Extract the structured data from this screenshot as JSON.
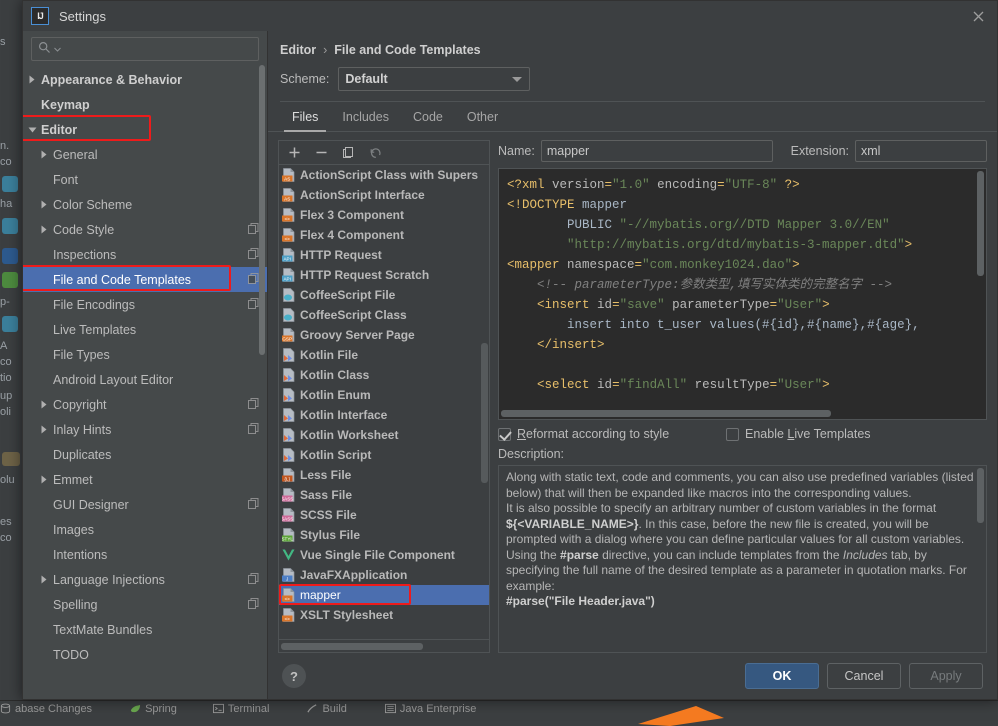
{
  "window": {
    "title": "Settings",
    "logo_text": "IJ",
    "close_icon": "close-icon"
  },
  "sidebar": {
    "search": {
      "placeholder": "",
      "value": "",
      "icon": "search-icon"
    },
    "items": [
      {
        "label": "Appearance & Behavior",
        "level": 0,
        "arrow": "right",
        "bold": true,
        "copy": false,
        "selected": false
      },
      {
        "label": "Keymap",
        "level": 0,
        "arrow": "none",
        "bold": true,
        "copy": false,
        "selected": false
      },
      {
        "label": "Editor",
        "level": 0,
        "arrow": "down",
        "bold": true,
        "copy": false,
        "selected": false,
        "annotated": true
      },
      {
        "label": "General",
        "level": 1,
        "arrow": "right",
        "bold": false,
        "copy": false,
        "selected": false
      },
      {
        "label": "Font",
        "level": 1,
        "arrow": "none",
        "bold": false,
        "copy": false,
        "selected": false
      },
      {
        "label": "Color Scheme",
        "level": 1,
        "arrow": "right",
        "bold": false,
        "copy": false,
        "selected": false
      },
      {
        "label": "Code Style",
        "level": 1,
        "arrow": "right",
        "bold": false,
        "copy": true,
        "selected": false
      },
      {
        "label": "Inspections",
        "level": 1,
        "arrow": "none",
        "bold": false,
        "copy": true,
        "selected": false
      },
      {
        "label": "File and Code Templates",
        "level": 1,
        "arrow": "none",
        "bold": false,
        "copy": true,
        "selected": true,
        "annotated": true
      },
      {
        "label": "File Encodings",
        "level": 1,
        "arrow": "none",
        "bold": false,
        "copy": true,
        "selected": false
      },
      {
        "label": "Live Templates",
        "level": 1,
        "arrow": "none",
        "bold": false,
        "copy": false,
        "selected": false
      },
      {
        "label": "File Types",
        "level": 1,
        "arrow": "none",
        "bold": false,
        "copy": false,
        "selected": false
      },
      {
        "label": "Android Layout Editor",
        "level": 1,
        "arrow": "none",
        "bold": false,
        "copy": false,
        "selected": false
      },
      {
        "label": "Copyright",
        "level": 1,
        "arrow": "right",
        "bold": false,
        "copy": true,
        "selected": false
      },
      {
        "label": "Inlay Hints",
        "level": 1,
        "arrow": "right",
        "bold": false,
        "copy": true,
        "selected": false
      },
      {
        "label": "Duplicates",
        "level": 1,
        "arrow": "none",
        "bold": false,
        "copy": false,
        "selected": false
      },
      {
        "label": "Emmet",
        "level": 1,
        "arrow": "right",
        "bold": false,
        "copy": false,
        "selected": false
      },
      {
        "label": "GUI Designer",
        "level": 1,
        "arrow": "none",
        "bold": false,
        "copy": true,
        "selected": false
      },
      {
        "label": "Images",
        "level": 1,
        "arrow": "none",
        "bold": false,
        "copy": false,
        "selected": false
      },
      {
        "label": "Intentions",
        "level": 1,
        "arrow": "none",
        "bold": false,
        "copy": false,
        "selected": false
      },
      {
        "label": "Language Injections",
        "level": 1,
        "arrow": "right",
        "bold": false,
        "copy": true,
        "selected": false
      },
      {
        "label": "Spelling",
        "level": 1,
        "arrow": "none",
        "bold": false,
        "copy": true,
        "selected": false
      },
      {
        "label": "TextMate Bundles",
        "level": 1,
        "arrow": "none",
        "bold": false,
        "copy": false,
        "selected": false
      },
      {
        "label": "TODO",
        "level": 1,
        "arrow": "none",
        "bold": false,
        "copy": false,
        "selected": false
      }
    ]
  },
  "breadcrumb": {
    "parent": "Editor",
    "separator": "›",
    "current": "File and Code Templates"
  },
  "scheme": {
    "label": "Scheme:",
    "value": "Default"
  },
  "tabs": [
    {
      "label": "Files",
      "active": true
    },
    {
      "label": "Includes",
      "active": false
    },
    {
      "label": "Code",
      "active": false
    },
    {
      "label": "Other",
      "active": false
    }
  ],
  "list_toolbar": [
    {
      "name": "add-template-button",
      "glyph": "+"
    },
    {
      "name": "remove-template-button",
      "glyph": "−"
    },
    {
      "name": "copy-template-button",
      "glyph": "copy-icon"
    },
    {
      "name": "reset-template-button",
      "glyph": "undo-icon"
    }
  ],
  "templates": [
    {
      "label": "ActionScript Class with Supers",
      "icon": "as-file-icon",
      "selected": false
    },
    {
      "label": "ActionScript Interface",
      "icon": "as-file-icon",
      "selected": false
    },
    {
      "label": "Flex 3 Component",
      "icon": "xml-file-icon",
      "selected": false
    },
    {
      "label": "Flex 4 Component",
      "icon": "xml-file-icon",
      "selected": false
    },
    {
      "label": "HTTP Request",
      "icon": "api-file-icon",
      "selected": false
    },
    {
      "label": "HTTP Request Scratch",
      "icon": "api-file-icon",
      "selected": false
    },
    {
      "label": "CoffeeScript File",
      "icon": "coffee-file-icon",
      "selected": false
    },
    {
      "label": "CoffeeScript Class",
      "icon": "coffee-file-icon",
      "selected": false
    },
    {
      "label": "Groovy Server Page",
      "icon": "gsp-file-icon",
      "selected": false
    },
    {
      "label": "Kotlin File",
      "icon": "kotlin-file-icon",
      "selected": false
    },
    {
      "label": "Kotlin Class",
      "icon": "kotlin-file-icon",
      "selected": false
    },
    {
      "label": "Kotlin Enum",
      "icon": "kotlin-file-icon",
      "selected": false
    },
    {
      "label": "Kotlin Interface",
      "icon": "kotlin-file-icon",
      "selected": false
    },
    {
      "label": "Kotlin Worksheet",
      "icon": "kotlin-file-icon",
      "selected": false
    },
    {
      "label": "Kotlin Script",
      "icon": "kotlin-file-icon",
      "selected": false
    },
    {
      "label": "Less File",
      "icon": "less-file-icon",
      "selected": false
    },
    {
      "label": "Sass File",
      "icon": "sass-file-icon",
      "selected": false
    },
    {
      "label": "SCSS File",
      "icon": "sass-file-icon",
      "selected": false
    },
    {
      "label": "Stylus File",
      "icon": "stylus-file-icon",
      "selected": false
    },
    {
      "label": "Vue Single File Component",
      "icon": "vue-file-icon",
      "selected": false
    },
    {
      "label": "JavaFXApplication",
      "icon": "java-file-icon",
      "selected": false
    },
    {
      "label": "mapper",
      "icon": "xml-file-icon",
      "selected": true,
      "annotated": true
    },
    {
      "label": "XSLT Stylesheet",
      "icon": "xml-file-icon",
      "selected": false
    }
  ],
  "editor": {
    "name_label": "Name:",
    "name_value": "mapper",
    "extension_label": "Extension:",
    "extension_value": "xml",
    "code_lines": [
      "<?xml version=\"1.0\" encoding=\"UTF-8\" ?>",
      "<!DOCTYPE mapper",
      "        PUBLIC \"-//mybatis.org//DTD Mapper 3.0//EN\"",
      "        \"http://mybatis.org/dtd/mybatis-3-mapper.dtd\">",
      "<mapper namespace=\"com.monkey1024.dao\">",
      "    <!-- parameterType:参数类型,填写实体类的完整名字 -->",
      "    <insert id=\"save\" parameterType=\"User\">",
      "        insert into t_user values(#{id},#{name},#{age},",
      "    </insert>",
      "",
      "    <select id=\"findAll\" resultType=\"User\">"
    ]
  },
  "options": {
    "reformat": {
      "label": "Reformat according to style",
      "mnemonic": "R",
      "checked": true
    },
    "live_templates": {
      "label": "Enable Live Templates",
      "mnemonic": "L",
      "checked": false
    }
  },
  "description": {
    "label": "Description:",
    "paragraphs": [
      "Along with static text, code and comments, you can also use predefined variables (listed below) that will then be expanded like macros into the corresponding values.",
      "It is also possible to specify an arbitrary number of custom variables in the format ${<VARIABLE_NAME>}. In this case, before the new file is created, you will be prompted with a dialog where you can define particular values for all custom variables.",
      "Using the #parse directive, you can include templates from the Includes tab, by specifying the full name of the desired template as a parameter in quotation marks. For example:",
      "#parse(\"File Header.java\")"
    ]
  },
  "footer": {
    "help": "?",
    "ok": "OK",
    "cancel": "Cancel",
    "apply": "Apply"
  },
  "ide_bottom_bar": [
    {
      "label": "abase Changes",
      "icon": "database-icon"
    },
    {
      "label": "Spring",
      "icon": "spring-leaf-icon"
    },
    {
      "label": "Terminal",
      "icon": "terminal-icon"
    },
    {
      "label": "Build",
      "icon": "build-hammer-icon"
    },
    {
      "label": "Java Enterprise",
      "icon": "java-enterprise-icon"
    }
  ],
  "annotation_color": "#ee1b1b",
  "colors": {
    "selection_blue": "#4b6eaf",
    "primary_button": "#365880",
    "dialog_bg": "#3c3f41",
    "sidebar_bg": "#45494a",
    "code_bg": "#2b2b2b"
  }
}
